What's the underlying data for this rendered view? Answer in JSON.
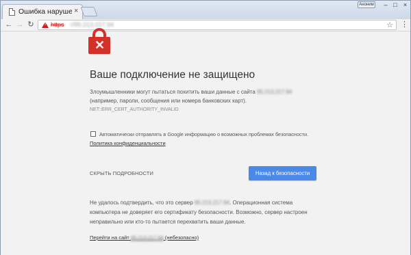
{
  "tab": {
    "title": "Ошибка нарушения конфиденциальности",
    "close": "×"
  },
  "window": {
    "user_badge": "Аноним",
    "min": "–",
    "max": "□",
    "close": "×"
  },
  "toolbar": {
    "back": "←",
    "forward": "→",
    "reload": "↻",
    "url_scheme": "https",
    "url_host": "://95.213.217.94",
    "star": "☆",
    "menu": "⋮"
  },
  "page": {
    "headline": "Ваше подключение не защищено",
    "para1_prefix": "Злоумышленники могут пытаться похитить ваши данные с сайта ",
    "para1_ip": "95.213.217.94",
    "para1_line2": "(например, пароли, сообщения или номера банковских карт).",
    "error_code": "NET::ERR_CERT_AUTHORITY_INVALID",
    "checkbox_label": "Автоматически отправлять в Google информацию о возможных проблемах безопасности.",
    "privacy_link": "Политика конфиденциальности",
    "details_button": "СКРЫТЬ ПОДРОБНОСТИ",
    "back_button": "Назад к безопасности",
    "details_prefix": "Не удалось подтвердить, что это сервер ",
    "details_ip": "95.213.217.94",
    "details_suffix": ". Операционная система",
    "details_line2": "компьютера не доверяет его сертификату безопасности. Возможно, сервер настроен",
    "details_line3": "неправильно или кто-то пытается перехватить ваши данные.",
    "proceed_prefix": "Перейти на сайт ",
    "proceed_ip": "95.213.217.94",
    "proceed_suffix": " (небезопасно)"
  },
  "colors": {
    "accent": "#4b89e6",
    "danger": "#d23028",
    "background": "#f2f2f2"
  },
  "icons": {
    "lock": "lock-error-icon",
    "warning": "not-secure-warning-icon"
  }
}
